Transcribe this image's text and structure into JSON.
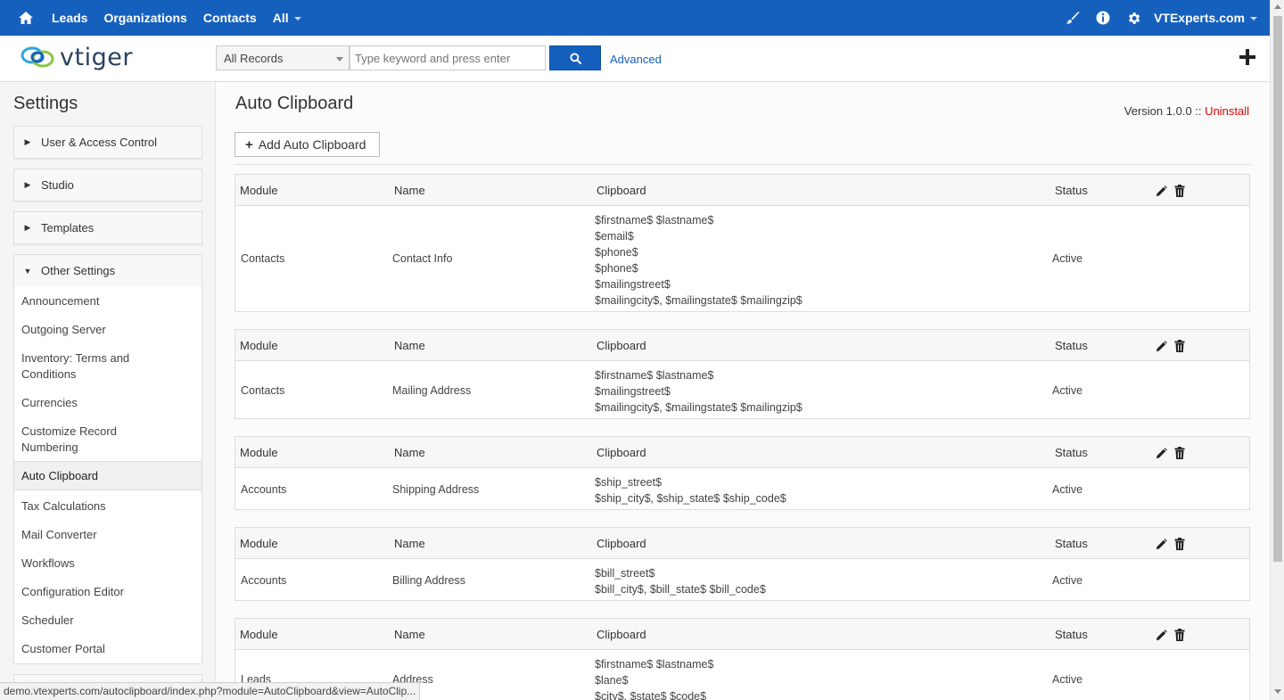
{
  "topnav": {
    "links": [
      "Leads",
      "Organizations",
      "Contacts",
      "All"
    ],
    "org": "VTExperts.com",
    "icons": [
      "home-icon",
      "brush-icon",
      "info-icon",
      "gear-icon"
    ]
  },
  "header": {
    "logo_text": "vtiger",
    "record_filter": "All Records",
    "search_placeholder": "Type keyword and press enter",
    "advanced_label": "Advanced"
  },
  "sidebar": {
    "title": "Settings",
    "groups": [
      "User & Access Control",
      "Studio",
      "Templates",
      "Other Settings"
    ],
    "items": [
      "Announcement",
      "Outgoing Server",
      "Inventory: Terms and Conditions",
      "Currencies",
      "Customize Record Numbering",
      "Auto Clipboard",
      "Tax Calculations",
      "Mail Converter",
      "Workflows",
      "Configuration Editor",
      "Scheduler",
      "Customer Portal"
    ],
    "active_item": "Auto Clipboard"
  },
  "main": {
    "title": "Auto Clipboard",
    "version_label": "Version 1.0.0 ::",
    "uninstall_label": "Uninstall",
    "add_button": "Add Auto Clipboard",
    "columns": {
      "module": "Module",
      "name": "Name",
      "clipboard": "Clipboard",
      "status": "Status"
    },
    "rows": [
      {
        "module": "Contacts",
        "name": "Contact Info",
        "clipboard": [
          "$firstname$ $lastname$",
          "$email$",
          "$phone$",
          "$phone$",
          "$mailingstreet$",
          "$mailingcity$, $mailingstate$ $mailingzip$"
        ],
        "status": "Active"
      },
      {
        "module": "Contacts",
        "name": "Mailing Address",
        "clipboard": [
          "$firstname$ $lastname$",
          "$mailingstreet$",
          "$mailingcity$, $mailingstate$ $mailingzip$"
        ],
        "status": "Active"
      },
      {
        "module": "Accounts",
        "name": "Shipping Address",
        "clipboard": [
          "$ship_street$",
          "$ship_city$, $ship_state$ $ship_code$"
        ],
        "status": "Active"
      },
      {
        "module": "Accounts",
        "name": "Billing Address",
        "clipboard": [
          "$bill_street$",
          "$bill_city$, $bill_state$ $bill_code$"
        ],
        "status": "Active"
      },
      {
        "module": "Leads",
        "name": "Address",
        "clipboard": [
          "$firstname$ $lastname$",
          "$lane$",
          "$city$, $state$ $code$"
        ],
        "status": "Active"
      }
    ]
  },
  "statusbar": {
    "url": "demo.vtexperts.com/autoclipboard/index.php?module=AutoClipboard&view=AutoClip..."
  },
  "colors": {
    "brand": "#1560bd",
    "danger": "#e60000"
  }
}
